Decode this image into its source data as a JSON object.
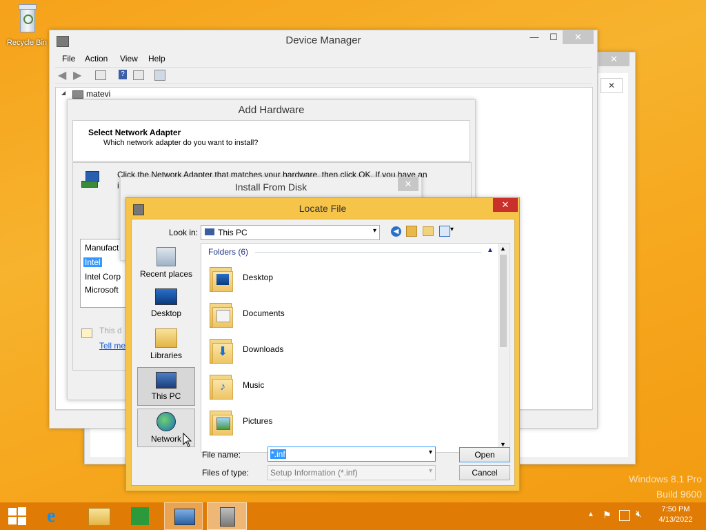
{
  "desktop": {
    "recycle_bin_label": "Recycle Bin",
    "watermark_line1": "Windows 8.1 Pro",
    "watermark_line2": "Build 9600"
  },
  "device_manager": {
    "title": "Device Manager",
    "menu": [
      "File",
      "Action",
      "View",
      "Help"
    ],
    "tree_root": "matevi"
  },
  "add_hardware": {
    "title": "Add Hardware",
    "heading": "Select Network Adapter",
    "subheading": "Which network adapter do you want to install?",
    "instruction": "Click the Network Adapter that matches your hardware, then click OK. If you have an",
    "instruction_cut": "i",
    "list_header": "Manufact",
    "list_items": [
      "Intel",
      "Intel Corp",
      "Microsoft"
    ],
    "selected_item": "Intel",
    "note_text": "This d",
    "link_text": "Tell me"
  },
  "install_from_disk": {
    "title": "Install From Disk"
  },
  "locate_file": {
    "title": "Locate File",
    "look_in_label": "Look in:",
    "look_in_value": "This PC",
    "places": [
      "Recent places",
      "Desktop",
      "Libraries",
      "This PC",
      "Network"
    ],
    "selected_place": "This PC",
    "group_header": "Folders (6)",
    "folders": [
      "Desktop",
      "Documents",
      "Downloads",
      "Music",
      "Pictures"
    ],
    "file_name_label": "File name:",
    "file_name_value": "*.inf",
    "file_type_label": "Files of type:",
    "file_type_value": "Setup Information (*.inf)",
    "open_label": "Open",
    "cancel_label": "Cancel"
  },
  "taskbar": {
    "time": "7:50 PM",
    "date": "4/13/2022"
  },
  "colors": {
    "accent": "#3399ff",
    "taskbar": "#e07c06",
    "close_red": "#c9302c",
    "selection": "#3399ff"
  }
}
